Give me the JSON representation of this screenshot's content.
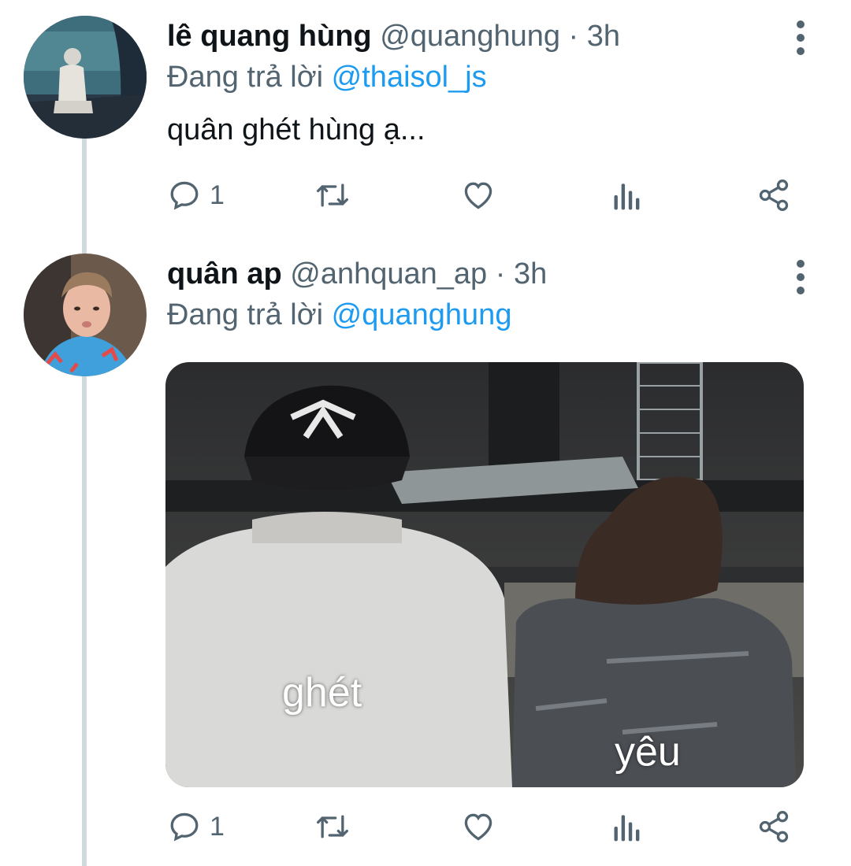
{
  "tweets": [
    {
      "name": "lê quang hùng",
      "handle": "@quanghung",
      "dot": "·",
      "time": "3h",
      "reply_prefix": "Đang trả lời",
      "reply_to": "@thaisol_js",
      "text": "quân ghét hùng ạ...",
      "replies": "1"
    },
    {
      "name": "quân ap",
      "handle": "@anhquan_ap",
      "dot": "·",
      "time": "3h",
      "reply_prefix": "Đang trả lời",
      "reply_to": "@quanghung",
      "media_captions": {
        "left": "ghét",
        "right": "yêu"
      },
      "replies": "1"
    }
  ],
  "icons": {
    "reply": "comment-bubble-icon",
    "retweet": "retweet-icon",
    "like": "heart-icon",
    "views": "analytics-icon",
    "share": "share-icon",
    "more": "more-vertical-icon"
  },
  "colors": {
    "text": "#0f1419",
    "secondary": "#536471",
    "link": "#1d9bf0",
    "thread_line": "#cfd9de"
  }
}
